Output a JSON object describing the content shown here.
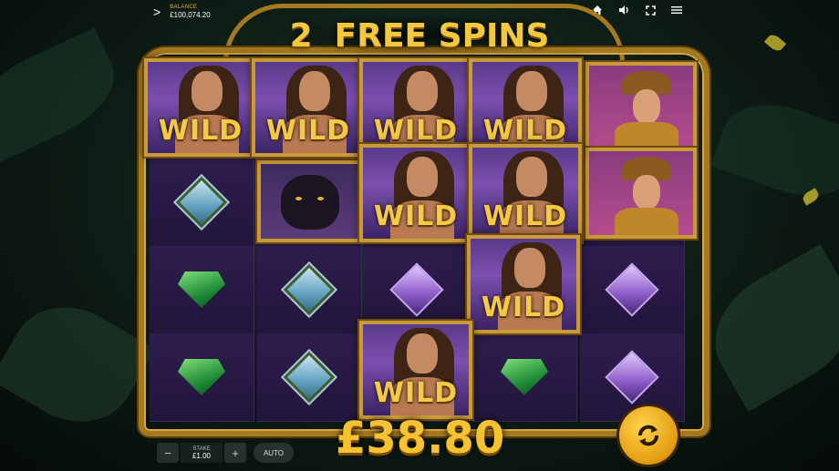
{
  "topbar": {
    "menu_chevron": ">",
    "balance_label": "BALANCE",
    "balance_value": "£100,074.20"
  },
  "icons": [
    "home-icon",
    "volume-icon",
    "fullscreen-icon",
    "hamburger-menu-icon",
    "reload-icon"
  ],
  "free_spins": {
    "count": "2",
    "label": "FREE SPINS"
  },
  "reels": {
    "wild_label": "WILD",
    "symbols": [
      [
        "wild",
        "wild",
        "wild",
        "wild",
        "explorer"
      ],
      [
        "diamond",
        "panther",
        "wild",
        "wild",
        "explorer"
      ],
      [
        "emerald",
        "diamond",
        "amethyst",
        "wild",
        "amethyst"
      ],
      [
        "emerald",
        "diamond",
        "wild",
        "emerald",
        "amethyst"
      ]
    ]
  },
  "controls": {
    "stake_minus": "−",
    "stake_label": "STAKE",
    "stake_value": "£1.00",
    "stake_plus": "+",
    "auto_label": "AUTO",
    "win_amount": "£38.80"
  },
  "colors": {
    "gold": "#f2c83e",
    "reel_bg": "#2d1d4d",
    "spin_button": "#e39c12"
  }
}
